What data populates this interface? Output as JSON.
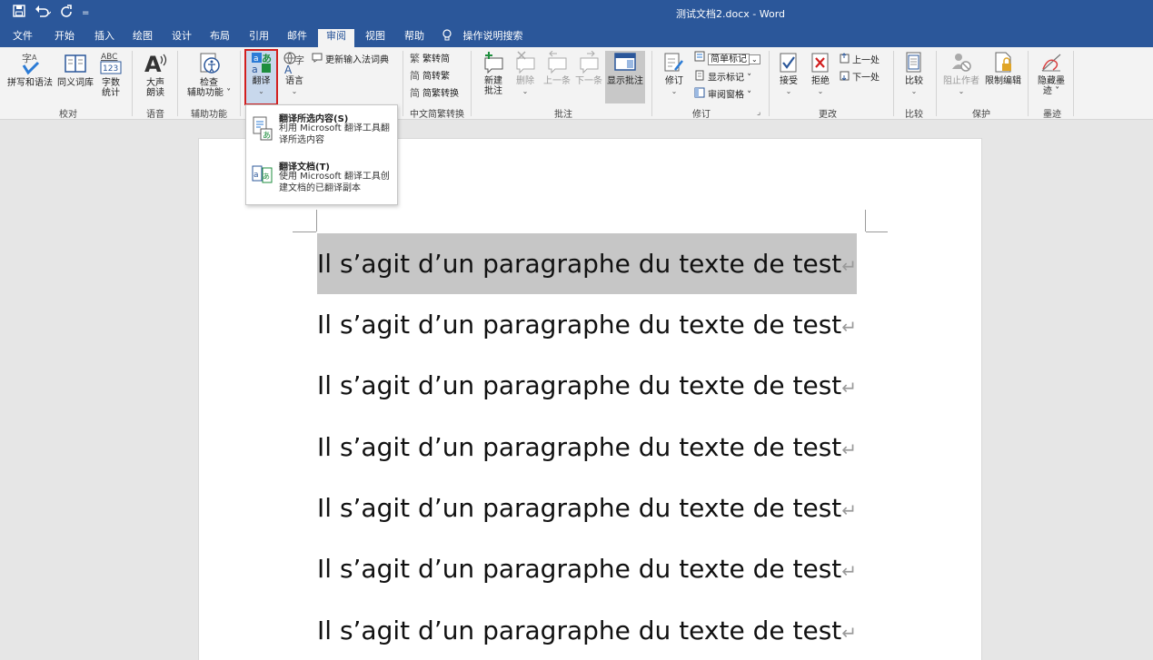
{
  "window": {
    "title": "测试文档2.docx  -  Word",
    "qat": {
      "save_icon": "save-icon",
      "undo_icon": "undo-icon",
      "redo_icon": "redo-icon",
      "customize": "customize-qat"
    }
  },
  "menu_tabs": [
    {
      "label": "文件"
    },
    {
      "label": "开始"
    },
    {
      "label": "插入"
    },
    {
      "label": "绘图"
    },
    {
      "label": "设计"
    },
    {
      "label": "布局"
    },
    {
      "label": "引用"
    },
    {
      "label": "邮件"
    },
    {
      "label": "审阅",
      "active": true
    },
    {
      "label": "视图"
    },
    {
      "label": "帮助"
    }
  ],
  "tell_me": "操作说明搜索",
  "ribbon": {
    "proofing": {
      "group_label": "校对",
      "spelling": "拼写和语法",
      "thesaurus": "同义词库",
      "wordcount_1": "字数",
      "wordcount_2": "统计",
      "abc": "ABC",
      "num": "123"
    },
    "speech": {
      "group_label": "语音",
      "read_1": "大声",
      "read_2": "朗读"
    },
    "accessibility": {
      "group_label": "辅助功能",
      "check_1": "检查",
      "check_2": "辅助功能 ˅"
    },
    "language": {
      "translate": "翻译",
      "language": "语言",
      "update_ime": "更新输入法词典"
    },
    "chinese": {
      "group_label": "中文简繁转换",
      "to_simplified": "繁转简",
      "to_traditional": "简转繁",
      "convert": "简繁转换"
    },
    "comments": {
      "group_label": "批注",
      "new_1": "新建",
      "new_2": "批注",
      "delete": "删除",
      "prev": "上一条",
      "next": "下一条",
      "show": "显示批注"
    },
    "tracking": {
      "group_label": "修订",
      "track": "修订",
      "markup_select": "简单标记",
      "show_markup": "显示标记 ˅",
      "review_pane": "审阅窗格 ˅"
    },
    "changes": {
      "group_label": "更改",
      "accept": "接受",
      "reject": "拒绝",
      "previous": "上一处",
      "next": "下一处"
    },
    "compare": {
      "group_label": "比较",
      "compare": "比较"
    },
    "protect": {
      "group_label": "保护",
      "block_authors": "阻止作者",
      "restrict": "限制编辑"
    },
    "ink": {
      "group_label": "墨迹",
      "hide_1": "隐藏墨",
      "hide_2": "迹 ˅"
    }
  },
  "translate_menu": {
    "items": [
      {
        "title": "翻译所选内容(S)",
        "desc": "利用 Microsoft 翻译工具翻译所选内容"
      },
      {
        "title": "翻译文档(T)",
        "desc": "使用 Microsoft 翻译工具创建文档的已翻译副本"
      }
    ]
  },
  "document": {
    "paragraphs": [
      "Il s’agit d’un paragraphe du texte de test",
      "Il s’agit d’un paragraphe du texte de test",
      "Il s’agit d’un paragraphe du texte de test",
      "Il s’agit d’un paragraphe du texte de test",
      "Il s’agit d’un paragraphe du texte de test",
      "Il s’agit d’un paragraphe du texte de test",
      "Il s’agit d’un paragraphe du texte de test"
    ],
    "paragraph_mark": "↵"
  },
  "colors": {
    "accent": "#2b579a",
    "highlight_border": "#d21f1f",
    "selection": "#c6c6c6"
  }
}
